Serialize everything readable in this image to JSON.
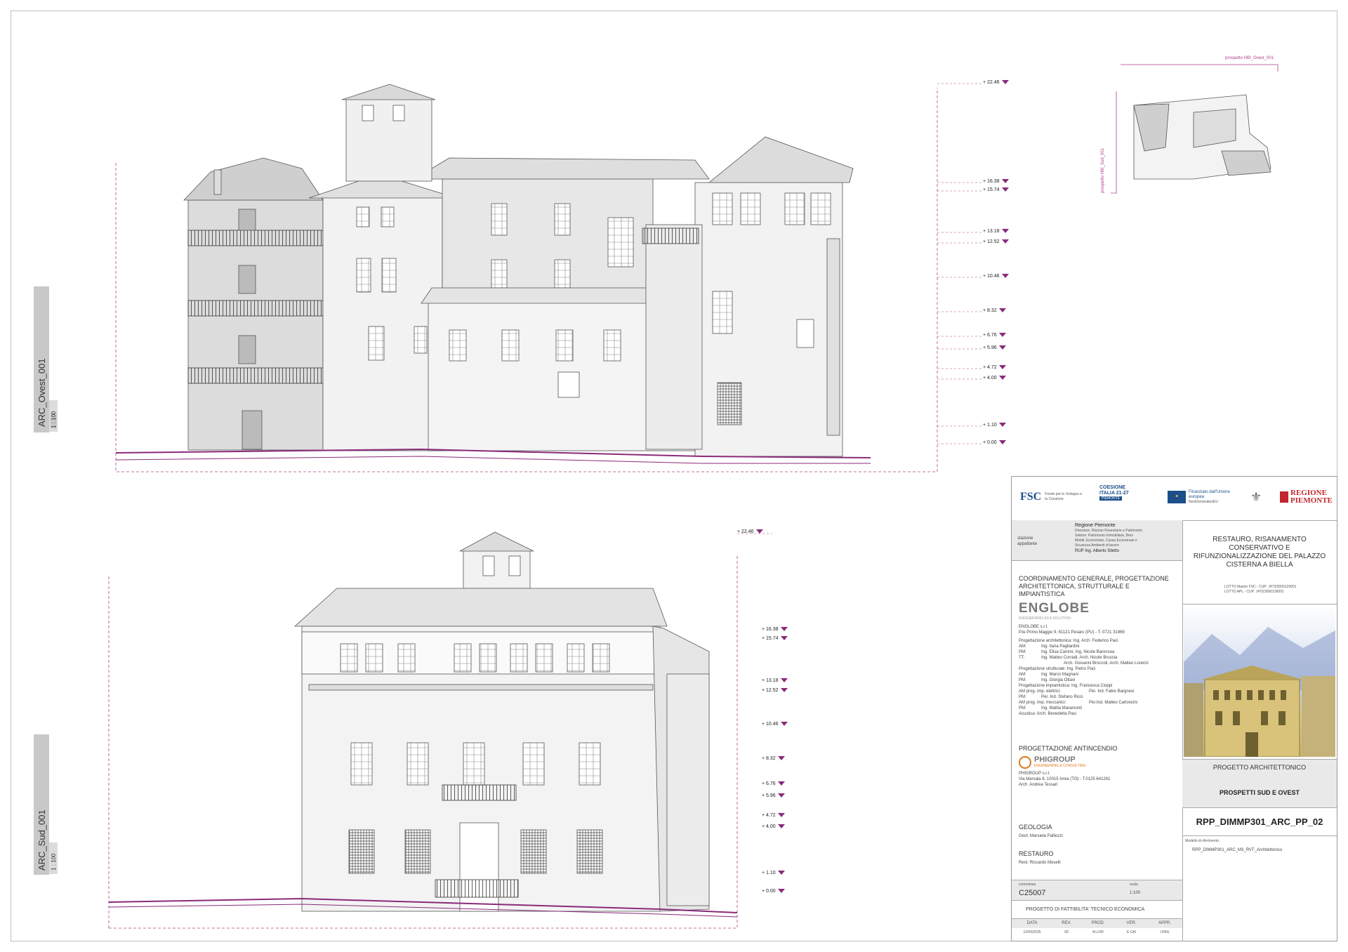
{
  "drawing": {
    "elevation_west": {
      "name": "ARC_Ovest_001",
      "scale": "1 : 100"
    },
    "elevation_south": {
      "name": "ARC_Sud_001",
      "scale": "1 : 100"
    },
    "keyplan": {
      "tag_west": "prospetto HBI_Ovest_001",
      "tag_south": "prospetto HBI_Sud_001"
    },
    "levels_west": [
      "+ 22.46",
      "+ 16.38",
      "+ 15.74",
      "+ 13.18",
      "+ 12.52",
      "+ 10.46",
      "+ 8.32",
      "+ 6.76",
      "+ 5.96",
      "+ 4.72",
      "+ 4.00",
      "+ 1.10",
      "+ 0.00"
    ],
    "levels_south": [
      "+ 22.46",
      "+ 16.38",
      "+ 15.74",
      "+ 13.18",
      "+ 12.52",
      "+ 10.46",
      "+ 8.32",
      "+ 6.76",
      "+ 5.96",
      "+ 4.72",
      "+ 4.00",
      "+ 1.10",
      "+ 0.00"
    ]
  },
  "title_block": {
    "logos": {
      "fsc": "FSC",
      "fsc_sub": "Fondo per lo Sviluppo e la Coesione",
      "coesione": "COESIONE ITALIA 21-27",
      "coesione_sub": "PIEMONTE",
      "eu": "Finanziato dall'Unione europea",
      "eu_sub": "NextGenerationEU",
      "regione": "REGIONE PIEMONTE"
    },
    "client": {
      "label": "stazione appaltante",
      "name": "Regione Piemonte",
      "lines": [
        "Direzione: Risorse Finanziarie e Patrimonio",
        "Settore: Patrimonio Immobiliare, Beni",
        "Mobili, Economato, Cassa Economale e",
        "Sicurezza Ambienti di lavoro"
      ],
      "rup": "RUP Ing. Alberto Siletto"
    },
    "coordination": {
      "title": "COORDINAMENTO GENERALE, PROGETTAZIONE ARCHITETTONICA, STRUTTURALE E IMPIANTISTICA",
      "company": "ENGLOBE",
      "company_tagline": "ENGINEERING AS A SOLUTION",
      "company_name": "ENGLOBE s.r.l.",
      "company_address": "P.le Primo Maggio 9, 61121 Pesaro (PU) - T. 0721 31969",
      "staff": [
        [
          "Progettazione architettonica: Ing. Arch. Federico Paci",
          ""
        ],
        [
          "AM:",
          "Ing. Ilaria Pagliardini"
        ],
        [
          "PM:",
          "Ing. Elisa Cammi, Ing. Nicole Baroncea"
        ],
        [
          "TT:",
          "Ing. Matteo Corradi, Arch. Nicole Bruscia"
        ],
        [
          "",
          "Arch. Giovanni Broccoli, Arch. Matteo Lorenzi"
        ],
        [
          "Progettazione strutturale: Ing. Pietro Paci",
          ""
        ],
        [
          "AM:",
          "Ing. Marco Magnani"
        ],
        [
          "PM:",
          "Ing. Giorgia Ottavi"
        ],
        [
          "Progettazione impiantistica: Ing. Francesca Cioppi",
          ""
        ],
        [
          "AM prog. imp. elettrici:",
          "Per. Ind. Fabio Bargnesi"
        ],
        [
          "PM:",
          "Per. Ind. Stefano Ricci"
        ],
        [
          "AM prog. imp. meccanici:",
          "Per.Ind. Matteo Carloncini"
        ],
        [
          "PM:",
          "Ing. Mattia Maramonti"
        ],
        [
          "Acustica: Arch. Benedetta Paci",
          ""
        ]
      ]
    },
    "fire": {
      "title": "PROGETTAZIONE ANTINCENDIO",
      "company": "PHIGROUP",
      "company_tagline": "ENGINEERING & CONSULTING",
      "company_name": "PHIGROUP s.r.l.",
      "address": "Via Marsala 8, 10015 Ivrea (TO) - T.0125 641261",
      "person": "Arch. Andrea Tessari"
    },
    "geology": {
      "title": "GEOLOGIA",
      "person": "Geol. Manuela Palliozzi"
    },
    "restoration": {
      "title": "RESTAURO",
      "person": "Rest. Riccardo Moselli"
    },
    "commessa": {
      "label": "commessa",
      "value": "C25007"
    },
    "scala": {
      "label": "scala",
      "value": "1:100"
    },
    "phase": "PROGETTO DI FATTIBILITA' TECNICO ECONOMICA",
    "revision": {
      "headers": [
        "DATA",
        "REV.",
        "PROD.",
        "VER.",
        "APPR."
      ],
      "row": [
        "12/09/2025",
        "00",
        "M.LOR",
        "E.CAI",
        "I.PAG"
      ]
    },
    "project": {
      "title": "RESTAURO, RISANAMENTO CONSERVATIVO E RIFUNZIONALIZZAZIONE DEL PALAZZO CISTERNA A BIELLA",
      "lotto1": "LOTTO Master FSC - CUP: J47I23000129001",
      "lotto2": "LOTTO APL - CUP: J47I23000130001"
    },
    "section": "PROGETTO ARCHITETTONICO",
    "sheet_title": "PROSPETTI SUD E OVEST",
    "code": "RPP_DIMMP301_ARC_PP_02",
    "model_label": "Modello di riferimento:",
    "model": "RPP_DIMMP301_ARC_M3_RVT_Architettonico"
  },
  "colors": {
    "accent": "#8a2a7a",
    "line": "#555555",
    "fill": "#f2f2f2",
    "shade": "#d9d9d9"
  }
}
